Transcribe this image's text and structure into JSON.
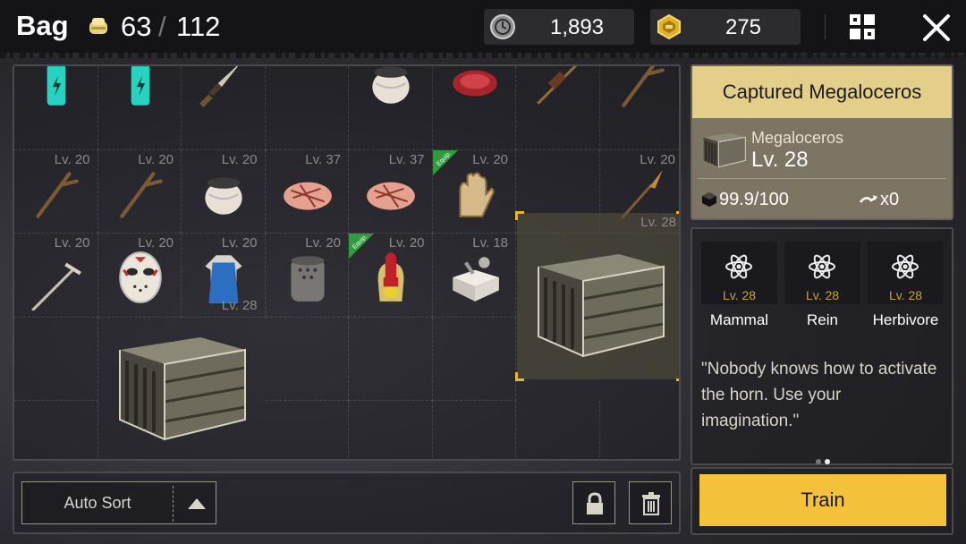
{
  "header": {
    "title": "Bag",
    "capacity_current": "63",
    "capacity_separator": "/",
    "capacity_max": "112",
    "coins": "1,893",
    "gold": "275"
  },
  "bag": {
    "cells": [
      {
        "item": "energy-drink-icon",
        "level": ""
      },
      {
        "item": "energy-drink-icon",
        "level": ""
      },
      {
        "item": "dagger-icon",
        "level": ""
      },
      {
        "item": "",
        "level": ""
      },
      {
        "item": "ceramic-pot-icon",
        "level": ""
      },
      {
        "item": "raw-meat-icon",
        "level": ""
      },
      {
        "item": "skewer-icon",
        "level": ""
      },
      {
        "item": "stick-icon",
        "level": ""
      },
      {
        "item": "stick-icon",
        "level": "Lv. 20"
      },
      {
        "item": "stick-icon",
        "level": "Lv. 20"
      },
      {
        "item": "ceramic-pot-icon",
        "level": "Lv. 20"
      },
      {
        "item": "cooked-meat-icon",
        "level": "Lv. 37"
      },
      {
        "item": "cooked-meat-icon",
        "level": "Lv. 37"
      },
      {
        "item": "gloves-icon",
        "level": "Lv. 20",
        "equip": "Equip."
      },
      {
        "item": "",
        "level": ""
      },
      {
        "item": "torch-icon",
        "level": "Lv. 20"
      },
      {
        "item": "pickaxe-icon",
        "level": "Lv. 20"
      },
      {
        "item": "hockey-mask-icon",
        "level": "Lv. 20"
      },
      {
        "item": "apron-icon",
        "level": "Lv. 20"
      },
      {
        "item": "beehive-icon",
        "level": "Lv. 20"
      },
      {
        "item": "spartan-helmet-icon",
        "level": "Lv. 20",
        "equip": "Equip."
      },
      {
        "item": "toolbox-icon",
        "level": "Lv. 18"
      },
      {
        "item": "crate-icon",
        "level": "Lv. 28"
      },
      {
        "item": "crate-icon",
        "level": "Lv. 28"
      }
    ]
  },
  "toolbar": {
    "sort_label": "Auto Sort"
  },
  "detail": {
    "title": "Captured Megaloceros",
    "species": "Megaloceros",
    "level": "Lv. 28",
    "durability": "99.9/100",
    "count": "x0",
    "traits": [
      {
        "icon": "atom-icon",
        "level": "Lv. 28",
        "name": "Mammal"
      },
      {
        "icon": "atom-icon",
        "level": "Lv. 28",
        "name": "Rein"
      },
      {
        "icon": "atom-icon",
        "level": "Lv. 28",
        "name": "Herbivore"
      }
    ],
    "quote": "\"Nobody knows how to activate the horn. Use your imagination.\"",
    "train_label": "Train"
  },
  "colors": {
    "accent": "#f4c23a",
    "title_bg": "#e3cf8a",
    "equip_badge": "#2e9b3c"
  }
}
